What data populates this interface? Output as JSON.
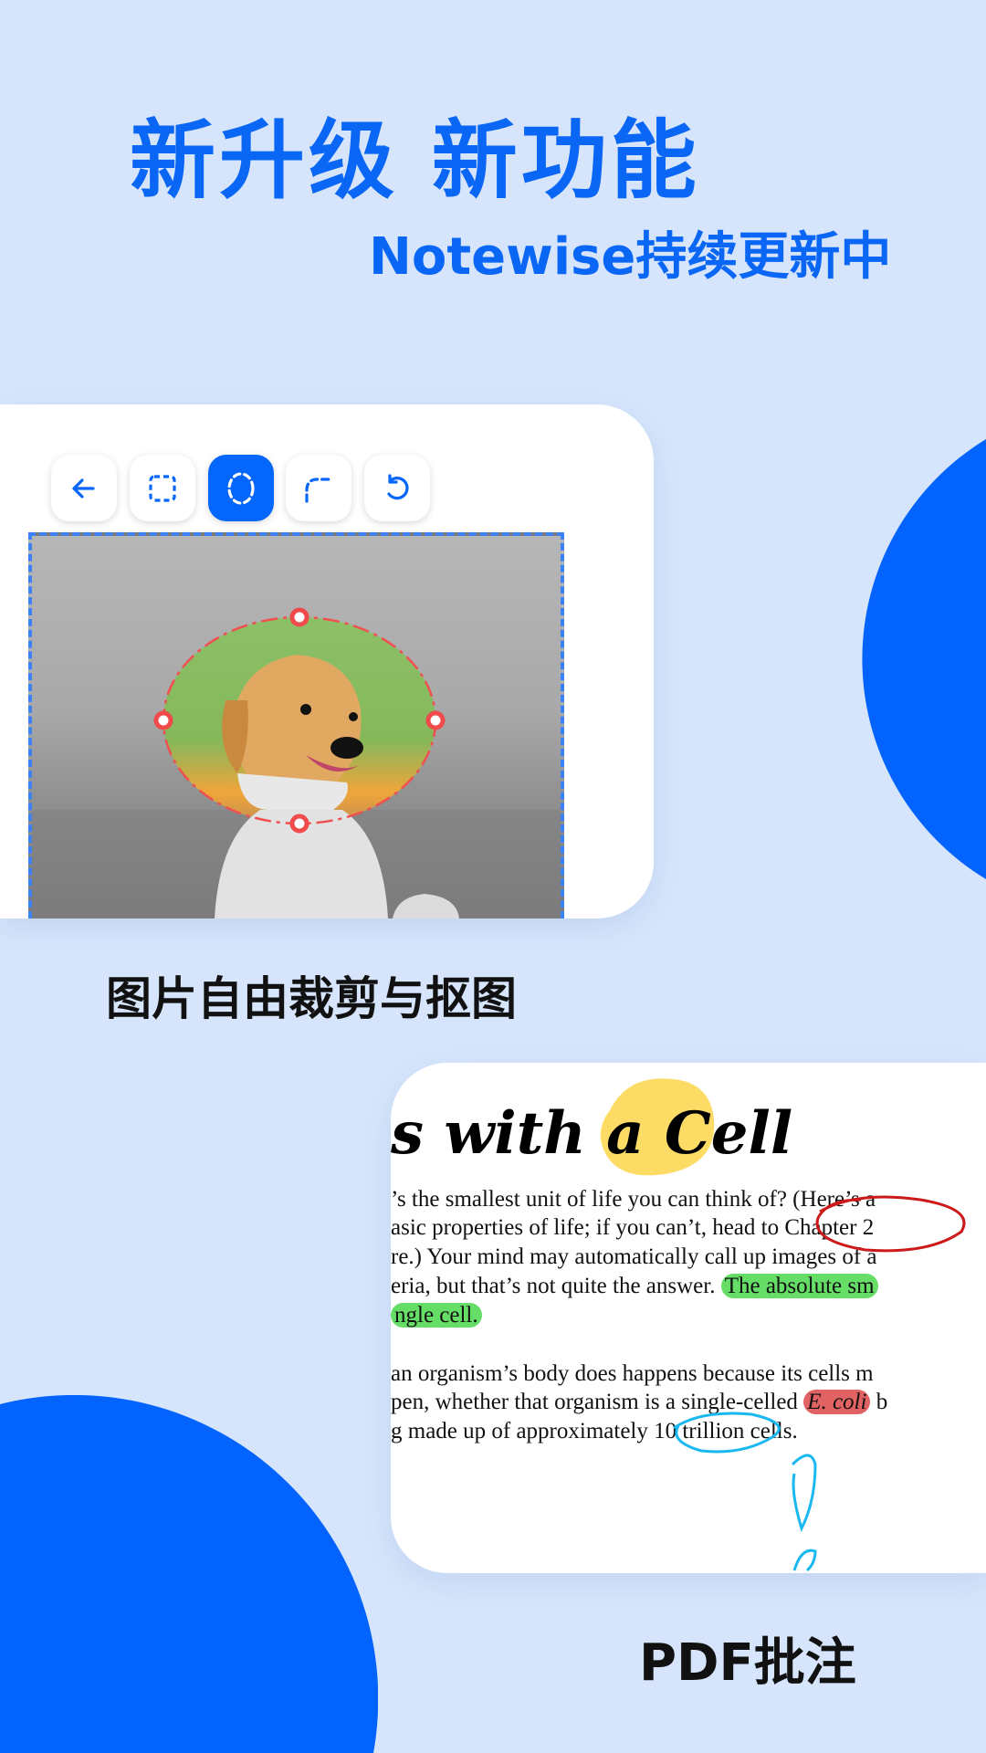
{
  "header": {
    "title": "新升级 新功能",
    "subtitle": "Notewise持续更新中"
  },
  "crop_card": {
    "toolbar": [
      {
        "icon": "arrow-left-icon",
        "active": false
      },
      {
        "icon": "rect-select-icon",
        "active": false
      },
      {
        "icon": "ellipse-select-icon",
        "active": true
      },
      {
        "icon": "corner-round-icon",
        "active": false
      },
      {
        "icon": "undo-icon",
        "active": false
      }
    ],
    "caption": "图片自由裁剪与抠图"
  },
  "pdf_card": {
    "title_prefix": "s with a ",
    "title_highlight": "Cell",
    "lines": [
      "’s the smallest unit of life you can think of? (Here’s a",
      "asic properties of life; if you can’t, head to Chapter 2",
      "re.) Your mind may automatically call up images of a",
      "eria, but that’s not quite the answer. ",
      "ngle cell.",
      "an organism’s body does happens because its cells m",
      "pen, whether that organism is a single-celled ",
      "g made up of approximately 10 trillion cells."
    ],
    "highlight_green_1": "The absolute sm",
    "highlight_red": "E. coli",
    "after_red": " b",
    "caption": "PDF批注"
  },
  "colors": {
    "accent": "#0263fe",
    "background": "#d6e5fb",
    "highlight_green": "#66dd66",
    "highlight_yellow": "#fddc66",
    "highlight_red": "#e06262",
    "pen_blue": "#1ab8f0",
    "pen_red": "#cc1a1a"
  }
}
